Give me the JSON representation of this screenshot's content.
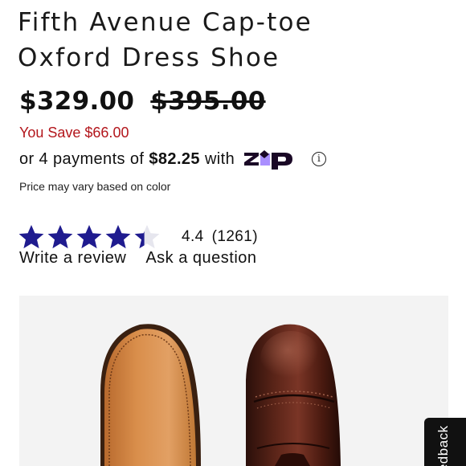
{
  "product": {
    "title_line1": "Fifth Avenue Cap-toe",
    "title_line2": "Oxford Dress Shoe"
  },
  "pricing": {
    "sale_price": "$329.00",
    "original_price": "$395.00",
    "savings": "You Save $66.00",
    "installments": {
      "prefix": "or 4 payments of",
      "amount": "$82.25",
      "suffix": "with",
      "provider_icon": "zip-logo",
      "info_icon": "info-icon"
    },
    "note": "Price may vary based on color"
  },
  "rating": {
    "stars_filled": 4.4,
    "stars_max": 5,
    "value": "4.4",
    "count": "(1261)",
    "star_color": "#1f1b8f"
  },
  "actions": {
    "write_review": "Write a review",
    "ask_question": "Ask a question"
  },
  "image": {
    "subject": "brown leather cap-toe oxford shoes, sole and top view"
  },
  "feedback_tab": {
    "label": "Feedback"
  },
  "colors": {
    "sale_red": "#b3161c",
    "zip_purple": "#aa8fff",
    "zip_black": "#1a0826"
  }
}
